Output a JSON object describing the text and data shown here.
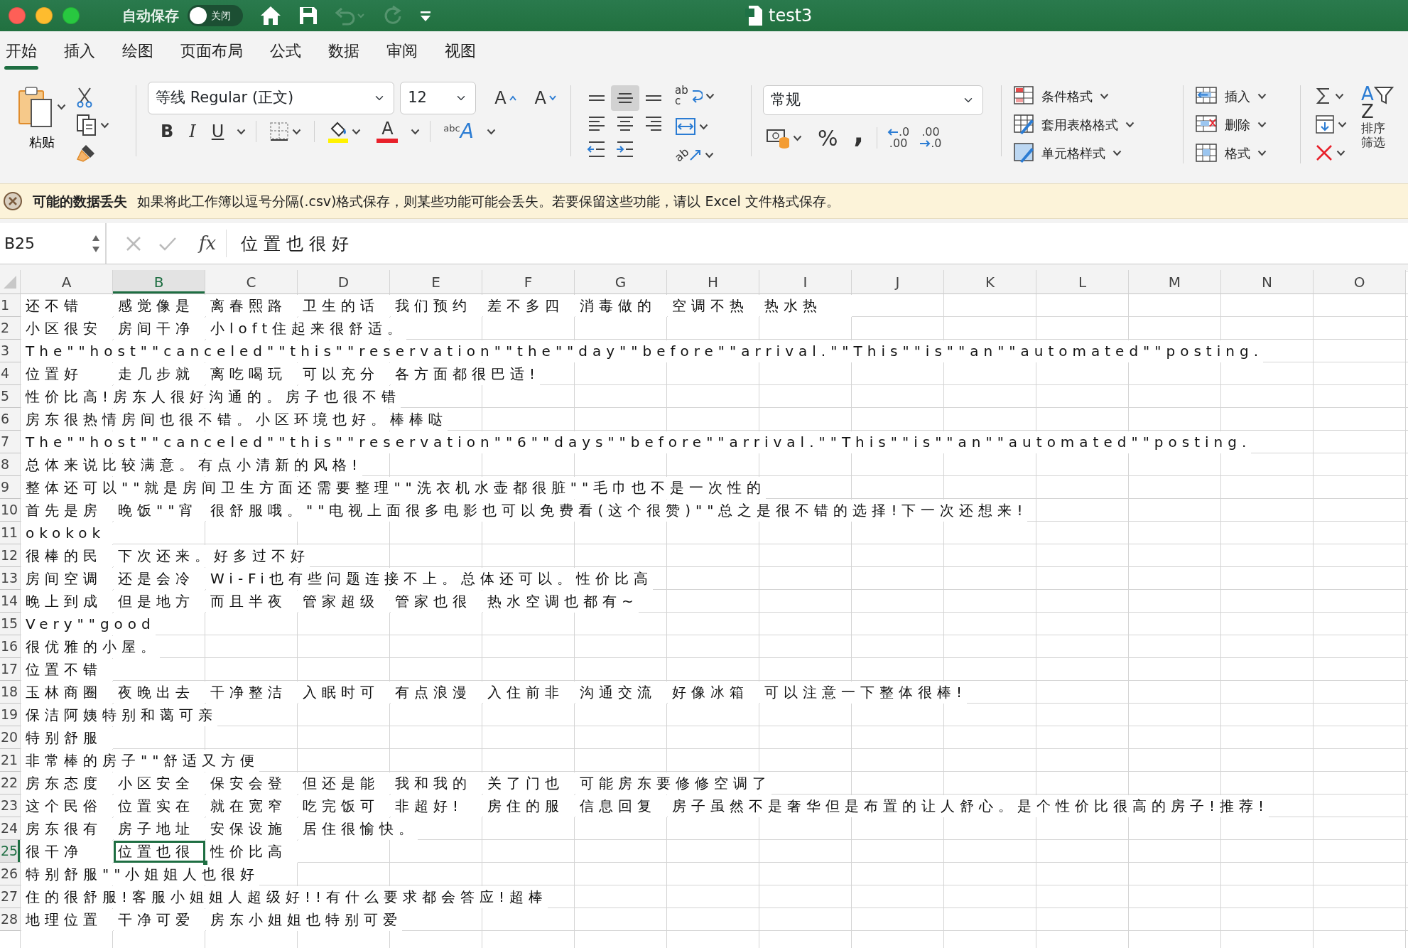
{
  "title_bar": {
    "autosave_label": "自动保存",
    "autosave": {
      "label": "关闭",
      "on": false
    },
    "undo": {
      "disabled": true
    },
    "redo": {
      "disabled": true
    },
    "title": "test3"
  },
  "tabs": [
    {
      "label": "开始",
      "selected": true
    },
    {
      "label": "插入",
      "selected": false
    },
    {
      "label": "绘图",
      "selected": false
    },
    {
      "label": "页面布局",
      "selected": false
    },
    {
      "label": "公式",
      "selected": false
    },
    {
      "label": "数据",
      "selected": false
    },
    {
      "label": "审阅",
      "selected": false
    },
    {
      "label": "视图",
      "selected": false
    }
  ],
  "ribbon": {
    "clipboard": {
      "paste_label": "粘贴"
    },
    "font": {
      "name": "等线 Regular (正文)",
      "size": "12",
      "grow_label": "A",
      "shrink_label": "A",
      "styles": [
        {
          "kind": "bold",
          "label": "B"
        },
        {
          "kind": "italic",
          "label": "I"
        },
        {
          "kind": "underline",
          "label": "U"
        }
      ],
      "font_color_label": "A",
      "text_effect": {
        "small": "abc",
        "large": "A"
      }
    },
    "alignment": {
      "buttons": [
        {
          "kind": "top",
          "selected": false
        },
        {
          "kind": "middle",
          "selected": true
        },
        {
          "kind": "bottom",
          "selected": false
        },
        {
          "kind": "left",
          "selected": false
        },
        {
          "kind": "center",
          "selected": false
        },
        {
          "kind": "right",
          "selected": false
        }
      ],
      "wrap_label": [
        "ab",
        "c"
      ],
      "orientation_label": "ab"
    },
    "number": {
      "format": "常规",
      "percent": "%",
      "comma": ",",
      "decrease_decimal": [
        ".0",
        ".00"
      ],
      "increase_decimal": [
        ".00",
        ".0"
      ]
    },
    "styles": [
      {
        "kind": "conditional",
        "label": "条件格式"
      },
      {
        "kind": "table",
        "label": "套用表格格式"
      },
      {
        "kind": "cell",
        "label": "单元格样式"
      }
    ],
    "cells": [
      {
        "kind": "insert",
        "label": "插入"
      },
      {
        "kind": "delete",
        "label": "删除"
      },
      {
        "kind": "format",
        "label": "格式"
      }
    ],
    "editing": {
      "sort_letters": [
        "A",
        "Z"
      ],
      "sort_label": [
        "排序",
        "筛选"
      ]
    }
  },
  "message_bar": {
    "title": "可能的数据丢失",
    "text": "如果将此工作簿以逗号分隔(.csv)格式保存，则某些功能可能会丢失。若要保留这些功能，请以 Excel 文件格式保存。"
  },
  "formula_bar": {
    "name_box": "B25",
    "fx": "fx",
    "formula": "位置也很好"
  },
  "sheet": {
    "columns": [
      "A",
      "B",
      "C",
      "D",
      "E",
      "F",
      "G",
      "H",
      "I",
      "J",
      "K",
      "L",
      "M",
      "N",
      "O"
    ],
    "rows": [
      {
        "number": "1",
        "cells": {
          "A": {
            "text": "还不错",
            "selected": false
          },
          "B": {
            "text": "感觉像是",
            "selected": false
          },
          "C": {
            "text": "离春熙路",
            "selected": false
          },
          "D": {
            "text": "卫生的话",
            "selected": false
          },
          "E": {
            "text": "我们预约",
            "selected": false
          },
          "F": {
            "text": "差不多四",
            "selected": false
          },
          "G": {
            "text": "消毒做的",
            "selected": false
          },
          "H": {
            "text": "空调不热",
            "selected": false
          },
          "I": {
            "text": "热水热",
            "selected": false
          }
        }
      },
      {
        "number": "2",
        "cells": {
          "A": {
            "text": "小区很安",
            "selected": false
          },
          "B": {
            "text": "房间干净",
            "selected": false
          },
          "C": {
            "text": "小loft住起来很舒适。",
            "selected": false
          }
        }
      },
      {
        "number": "3",
        "cells": {
          "A": {
            "text": "The\"\"host\"\"canceled\"\"this\"\"reservation\"\"the\"\"day\"\"before\"\"arrival.\"\"This\"\"is\"\"an\"\"automated\"\"posting.",
            "selected": false
          }
        }
      },
      {
        "number": "4",
        "cells": {
          "A": {
            "text": "位置好",
            "selected": false
          },
          "B": {
            "text": "走几步就",
            "selected": false
          },
          "C": {
            "text": "离吃喝玩",
            "selected": false
          },
          "D": {
            "text": "可以充分",
            "selected": false
          },
          "E": {
            "text": "各方面都很巴适!",
            "selected": false
          }
        }
      },
      {
        "number": "5",
        "cells": {
          "A": {
            "text": "性价比高!房东人很好沟通的。房子也很不错",
            "selected": false
          }
        }
      },
      {
        "number": "6",
        "cells": {
          "A": {
            "text": "房东很热情房间也很不错。小区环境也好。棒棒哒",
            "selected": false
          }
        }
      },
      {
        "number": "7",
        "cells": {
          "A": {
            "text": "The\"\"host\"\"canceled\"\"this\"\"reservation\"\"6\"\"days\"\"before\"\"arrival.\"\"This\"\"is\"\"an\"\"automated\"\"posting.",
            "selected": false
          }
        }
      },
      {
        "number": "8",
        "cells": {
          "A": {
            "text": "总体来说比较满意。有点小清新的风格!",
            "selected": false
          }
        }
      },
      {
        "number": "9",
        "cells": {
          "A": {
            "text": "整体还可以\"\"就是房间卫生方面还需要整理\"\"洗衣机水壶都很脏\"\"毛巾也不是一次性的",
            "selected": false
          }
        }
      },
      {
        "number": "10",
        "cells": {
          "A": {
            "text": "首先是房",
            "selected": false
          },
          "B": {
            "text": "晚饭\"\"宵",
            "selected": false
          },
          "C": {
            "text": "很舒服哦。\"\"电视上面很多电影也可以免费看(这个很赞)\"\"总之是很不错的选择!下一次还想来!",
            "selected": false
          }
        }
      },
      {
        "number": "11",
        "cells": {
          "A": {
            "text": "okokok",
            "selected": false
          }
        }
      },
      {
        "number": "12",
        "cells": {
          "A": {
            "text": "很棒的民",
            "selected": false
          },
          "B": {
            "text": "下次还来。好多过不好",
            "selected": false
          }
        }
      },
      {
        "number": "13",
        "cells": {
          "A": {
            "text": "房间空调",
            "selected": false
          },
          "B": {
            "text": "还是会冷",
            "selected": false
          },
          "C": {
            "text": "Wi-Fi也有些问题连接不上。总体还可以。性价比高",
            "selected": false
          }
        }
      },
      {
        "number": "14",
        "cells": {
          "A": {
            "text": "晚上到成",
            "selected": false
          },
          "B": {
            "text": "但是地方",
            "selected": false
          },
          "C": {
            "text": "而且半夜",
            "selected": false
          },
          "D": {
            "text": "管家超级",
            "selected": false
          },
          "E": {
            "text": "管家也很",
            "selected": false
          },
          "F": {
            "text": "热水空调也都有~",
            "selected": false
          }
        }
      },
      {
        "number": "15",
        "cells": {
          "A": {
            "text": "Very\"\"good",
            "selected": false
          }
        }
      },
      {
        "number": "16",
        "cells": {
          "A": {
            "text": "很优雅的小屋。",
            "selected": false
          }
        }
      },
      {
        "number": "17",
        "cells": {
          "A": {
            "text": "位置不错",
            "selected": false
          }
        }
      },
      {
        "number": "18",
        "cells": {
          "A": {
            "text": "玉林商圈",
            "selected": false
          },
          "B": {
            "text": "夜晚出去",
            "selected": false
          },
          "C": {
            "text": "干净整洁",
            "selected": false
          },
          "D": {
            "text": "入眠时可",
            "selected": false
          },
          "E": {
            "text": "有点浪漫",
            "selected": false
          },
          "F": {
            "text": "入住前非",
            "selected": false
          },
          "G": {
            "text": "沟通交流",
            "selected": false
          },
          "H": {
            "text": "好像冰箱",
            "selected": false
          },
          "I": {
            "text": "可以注意一下整体很棒!",
            "selected": false
          }
        }
      },
      {
        "number": "19",
        "cells": {
          "A": {
            "text": "保洁阿姨特别和蔼可亲",
            "selected": false
          }
        }
      },
      {
        "number": "20",
        "cells": {
          "A": {
            "text": "特别舒服",
            "selected": false
          }
        }
      },
      {
        "number": "21",
        "cells": {
          "A": {
            "text": "非常棒的房子\"\"舒适又方便",
            "selected": false
          }
        }
      },
      {
        "number": "22",
        "cells": {
          "A": {
            "text": "房东态度",
            "selected": false
          },
          "B": {
            "text": "小区安全",
            "selected": false
          },
          "C": {
            "text": "保安会登",
            "selected": false
          },
          "D": {
            "text": "但还是能",
            "selected": false
          },
          "E": {
            "text": "我和我的",
            "selected": false
          },
          "F": {
            "text": "关了门也",
            "selected": false
          },
          "G": {
            "text": "可能房东要修修空调了",
            "selected": false
          }
        }
      },
      {
        "number": "23",
        "cells": {
          "A": {
            "text": "这个民俗",
            "selected": false
          },
          "B": {
            "text": "位置实在",
            "selected": false
          },
          "C": {
            "text": "就在宽窄",
            "selected": false
          },
          "D": {
            "text": "吃完饭可",
            "selected": false
          },
          "E": {
            "text": "非超好!",
            "selected": false
          },
          "F": {
            "text": "房住的服",
            "selected": false
          },
          "G": {
            "text": "信息回复",
            "selected": false
          },
          "H": {
            "text": "房子虽然不是奢华但是布置的让人舒心。是个性价比很高的房子!推荐!",
            "selected": false
          }
        }
      },
      {
        "number": "24",
        "cells": {
          "A": {
            "text": "房东很有",
            "selected": false
          },
          "B": {
            "text": "房子地址",
            "selected": false
          },
          "C": {
            "text": "安保设施",
            "selected": false
          },
          "D": {
            "text": "居住很愉快。",
            "selected": false
          }
        }
      },
      {
        "number": "25",
        "cells": {
          "A": {
            "text": "很干净",
            "selected": false
          },
          "B": {
            "text": "位置也很",
            "selected": true
          },
          "C": {
            "text": "性价比高",
            "selected": false
          }
        }
      },
      {
        "number": "26",
        "cells": {
          "A": {
            "text": "特别舒服\"\"小姐姐人也很好",
            "selected": false
          }
        }
      },
      {
        "number": "27",
        "cells": {
          "A": {
            "text": "住的很舒服!客服小姐姐人超级好!!有什么要求都会答应!超棒",
            "selected": false
          }
        }
      },
      {
        "number": "28",
        "cells": {
          "A": {
            "text": "地理位置",
            "selected": false
          },
          "B": {
            "text": "干净可爱",
            "selected": false
          },
          "C": {
            "text": "房东小姐姐也特别可爱",
            "selected": false
          }
        }
      }
    ]
  }
}
